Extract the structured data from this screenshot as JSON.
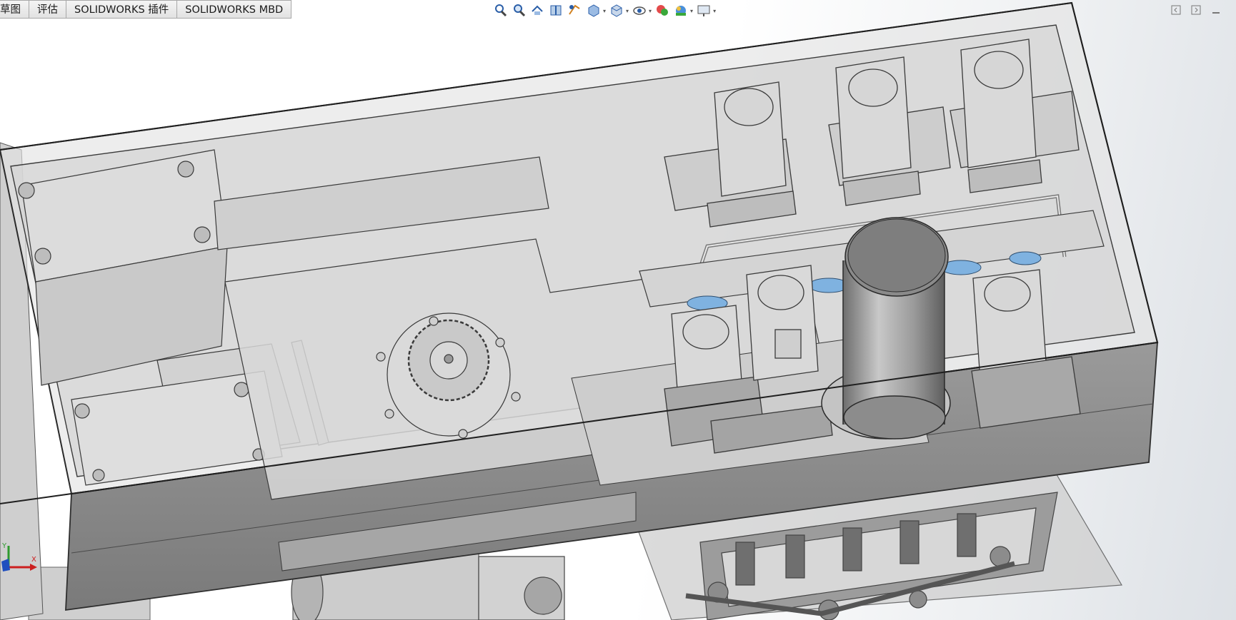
{
  "command_tabs": [
    {
      "label": "草图",
      "name": "tab-sketch"
    },
    {
      "label": "评估",
      "name": "tab-evaluate"
    },
    {
      "label": "SOLIDWORKS 插件",
      "name": "tab-solidworks-addins"
    },
    {
      "label": "SOLIDWORKS MBD",
      "name": "tab-solidworks-mbd"
    }
  ],
  "heads_up_toolbar": [
    {
      "name": "zoom-to-fit-icon"
    },
    {
      "name": "zoom-to-area-icon"
    },
    {
      "name": "previous-view-icon"
    },
    {
      "name": "section-view-icon"
    },
    {
      "name": "dynamic-annotation-icon"
    },
    {
      "name": "view-orientation-icon",
      "dropdown": true
    },
    {
      "name": "display-style-icon",
      "dropdown": true
    },
    {
      "name": "hide-show-items-icon",
      "dropdown": true
    },
    {
      "name": "edit-appearance-icon"
    },
    {
      "name": "apply-scene-icon",
      "dropdown": true
    },
    {
      "name": "view-settings-icon",
      "dropdown": true
    }
  ],
  "window_controls": [
    {
      "name": "tile-left-icon"
    },
    {
      "name": "tile-right-icon"
    },
    {
      "name": "minimize-icon"
    }
  ],
  "triad": {
    "y_label": "Y",
    "x_label": "X"
  },
  "colors": {
    "tab_border": "#a8a8a8",
    "model_line": "#3c3c3c",
    "model_fill_light": "#dedede",
    "model_fill_dark": "#8a8a8a",
    "accent_blue": "#7fb2e0"
  }
}
